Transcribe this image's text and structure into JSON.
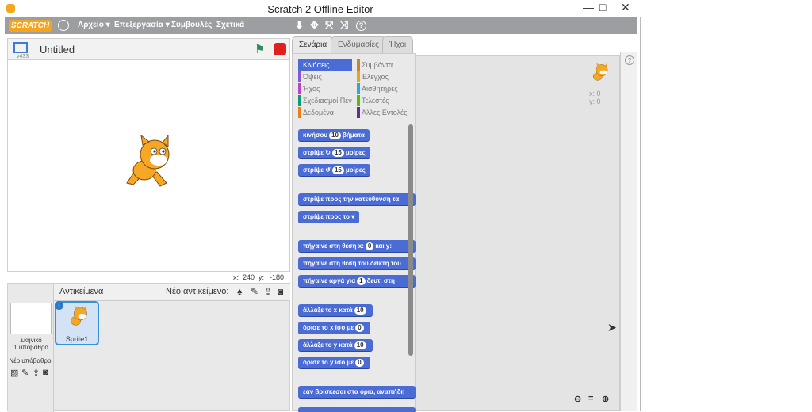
{
  "window": {
    "title": "Scratch 2 Offline Editor",
    "minimize": "—",
    "maximize": "□",
    "close": "✕"
  },
  "menu": {
    "logo": "SCRATCH",
    "items": [
      "Αρχείο ▾",
      "Επεξεργασία ▾",
      "Συμβουλές",
      "Σχετικά"
    ]
  },
  "toolbar": {
    "dup": "⬇",
    "cut": "✥",
    "grow": "⤧",
    "shrink": "⤨",
    "help": "?"
  },
  "stage": {
    "version": "v433",
    "project_name": "Untitled",
    "x_label": "x:",
    "x_val": "240",
    "y_label": "y:",
    "y_val": "-180"
  },
  "sprites": {
    "header": "Αντικείμενα",
    "new_sprite": "Νέο αντικείμενο:",
    "stage_label": "Σκηνικό",
    "backdrop_count": "1 υπόβαθρο",
    "new_backdrop": "Νέο υπόβαθρο:",
    "sprite1": "Sprite1"
  },
  "tabs": [
    "Σενάρια",
    "Ενδυμασίες",
    "Ήχοι"
  ],
  "categories": [
    {
      "label": "Κινήσεις",
      "color": "#4a6cd4"
    },
    {
      "label": "Συμβάντα",
      "color": "#c88330"
    },
    {
      "label": "Όψεις",
      "color": "#8a55d7"
    },
    {
      "label": "Έλεγχος",
      "color": "#e1a91a"
    },
    {
      "label": "Ήχος",
      "color": "#bb42c3"
    },
    {
      "label": "Αισθητήρες",
      "color": "#2ca5e2"
    },
    {
      "label": "Σχεδιασμοί Πένας",
      "color": "#0e9a6c"
    },
    {
      "label": "Τελεστές",
      "color": "#5cb712"
    },
    {
      "label": "Δεδομένα",
      "color": "#ee7d16"
    },
    {
      "label": "Άλλες Εντολές",
      "color": "#632d99"
    }
  ],
  "blocks": {
    "move": {
      "a": "κινήσου",
      "n": "10",
      "b": "βήματα"
    },
    "turn_r": {
      "a": "στρίψε ↻",
      "n": "15",
      "b": "μοίρες"
    },
    "turn_l": {
      "a": "στρίψε ↺",
      "n": "15",
      "b": "μοίρες"
    },
    "point_dir": "στρίψε προς την κατεύθυνση τα",
    "point_to": "στρίψε προς το ▾",
    "goto_xy": {
      "a": "πήγαινε στη θέση x:",
      "n1": "0",
      "b": "και y:"
    },
    "goto": "πήγαινε στη θέση του  δείκτη του",
    "glide": {
      "a": "πήγαινε αργά για",
      "n": "1",
      "b": "δευτ. στη"
    },
    "change_x": {
      "a": "άλλαξε το x κατά",
      "n": "10"
    },
    "set_x": {
      "a": "όρισε το x ίσο με",
      "n": "0"
    },
    "change_y": {
      "a": "άλλαξε το y κατά",
      "n": "10"
    },
    "set_y": {
      "a": "όρισε το y ίσο με",
      "n": "0"
    },
    "bounce": "εάν βρίσκεσαι στα όρια, αναπήδη"
  },
  "script_sprite": {
    "x": "x: 0",
    "y": "y: 0"
  },
  "zoom": {
    "out": "⊖",
    "reset": "=",
    "in": "⊕"
  }
}
